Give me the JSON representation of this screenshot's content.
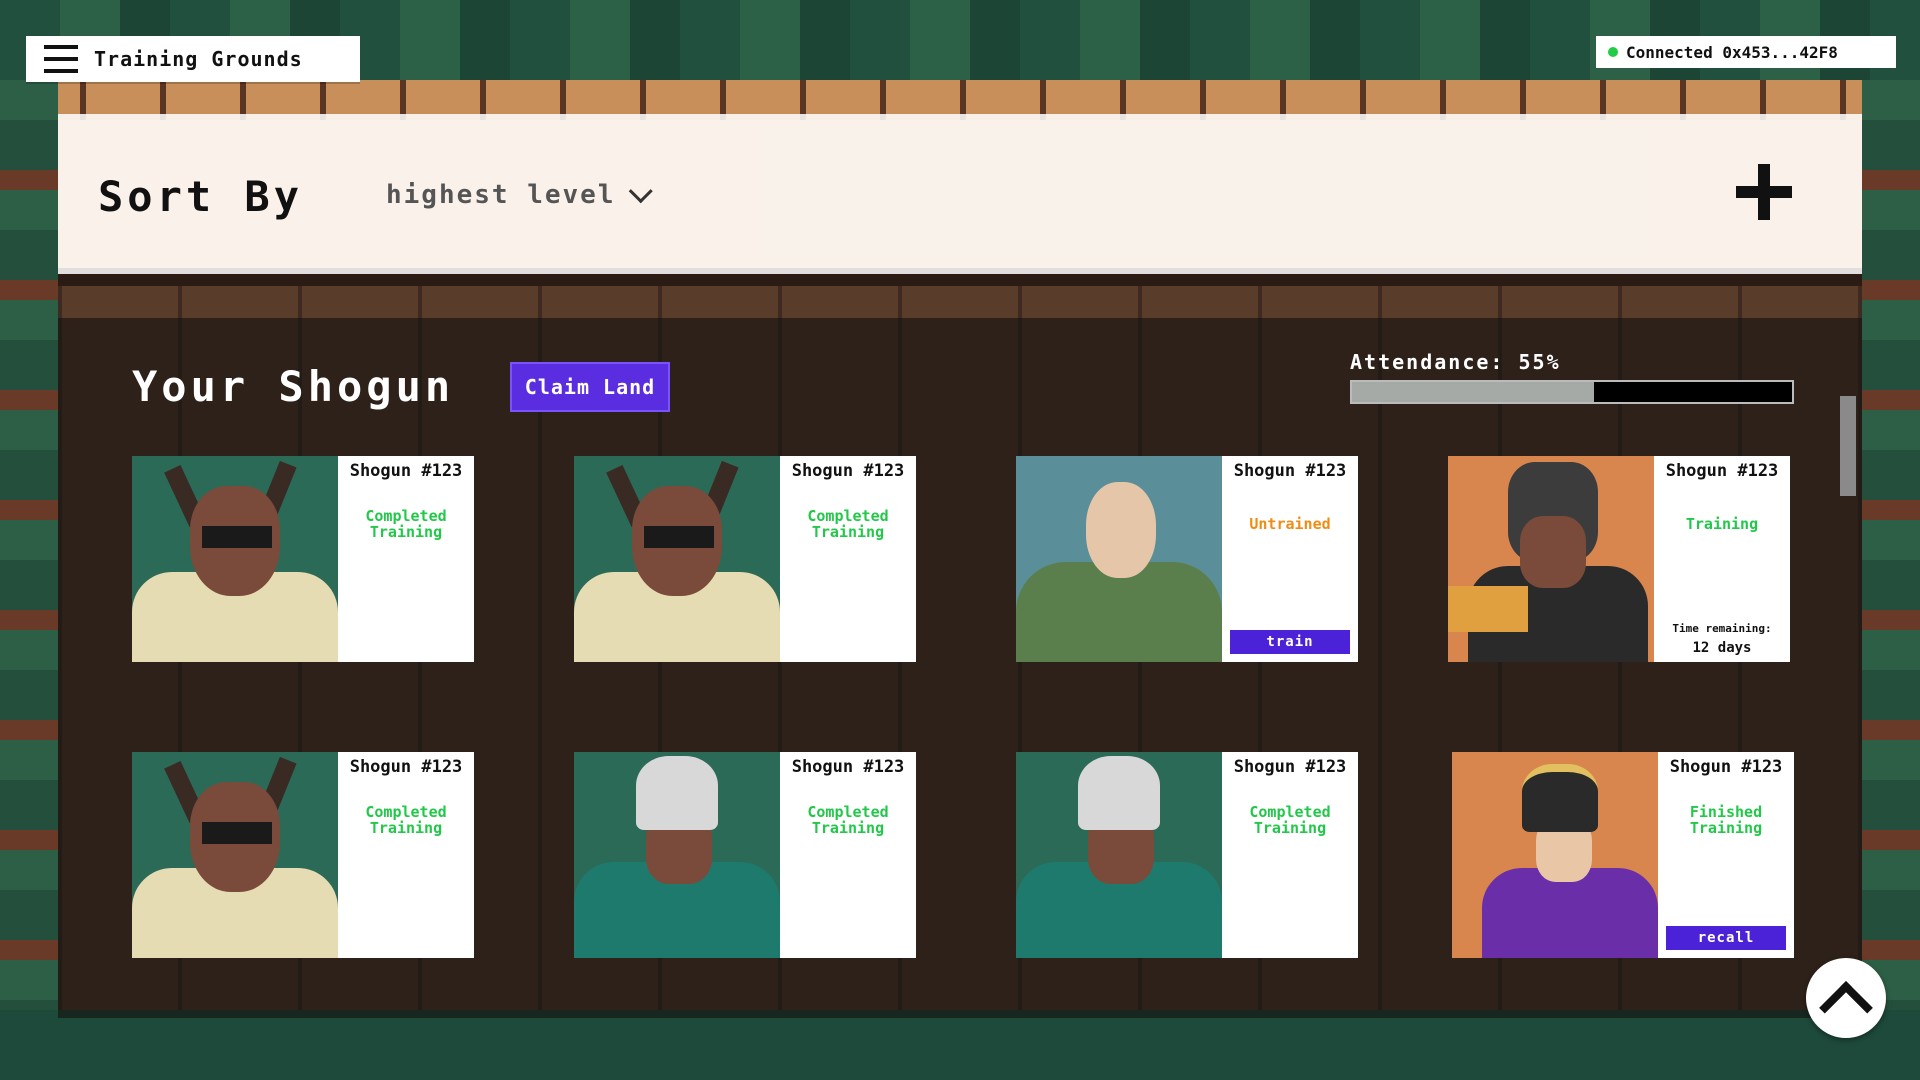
{
  "header": {
    "title": "Training Grounds",
    "wallet_status": "Connected 0x453...42F8",
    "status_color": "#22cc44"
  },
  "sort": {
    "label": "Sort By",
    "selected": "highest level",
    "add_icon": "plus-icon"
  },
  "shogun_panel": {
    "title": "Your Shogun",
    "claim_label": "Claim Land",
    "attendance_label": "Attendance: 55%",
    "attendance_value": 0.55,
    "accent_color": "#5b2de0"
  },
  "cards": [
    {
      "name": "Shogun #123",
      "status": "Completed Training"
    },
    {
      "name": "Shogun #123",
      "status": "Completed Training"
    },
    {
      "name": "Shogun #123",
      "status": "Untrained",
      "action": "train"
    },
    {
      "name": "Shogun #123",
      "status": "Training",
      "remaining_label": "Time remaining:",
      "remaining_value": "12 days"
    },
    {
      "name": "Shogun #123",
      "status": "Completed Training"
    },
    {
      "name": "Shogun #123",
      "status": "Completed Training"
    },
    {
      "name": "Shogun #123",
      "status": "Completed Training"
    },
    {
      "name": "Shogun #123",
      "status": "Finished Training",
      "action": "recall"
    }
  ],
  "status_colors": {
    "completed": "#23c84a",
    "untrained": "#f08c14",
    "training": "#23c84a"
  },
  "scroll_top_icon": "chevron-up-icon"
}
